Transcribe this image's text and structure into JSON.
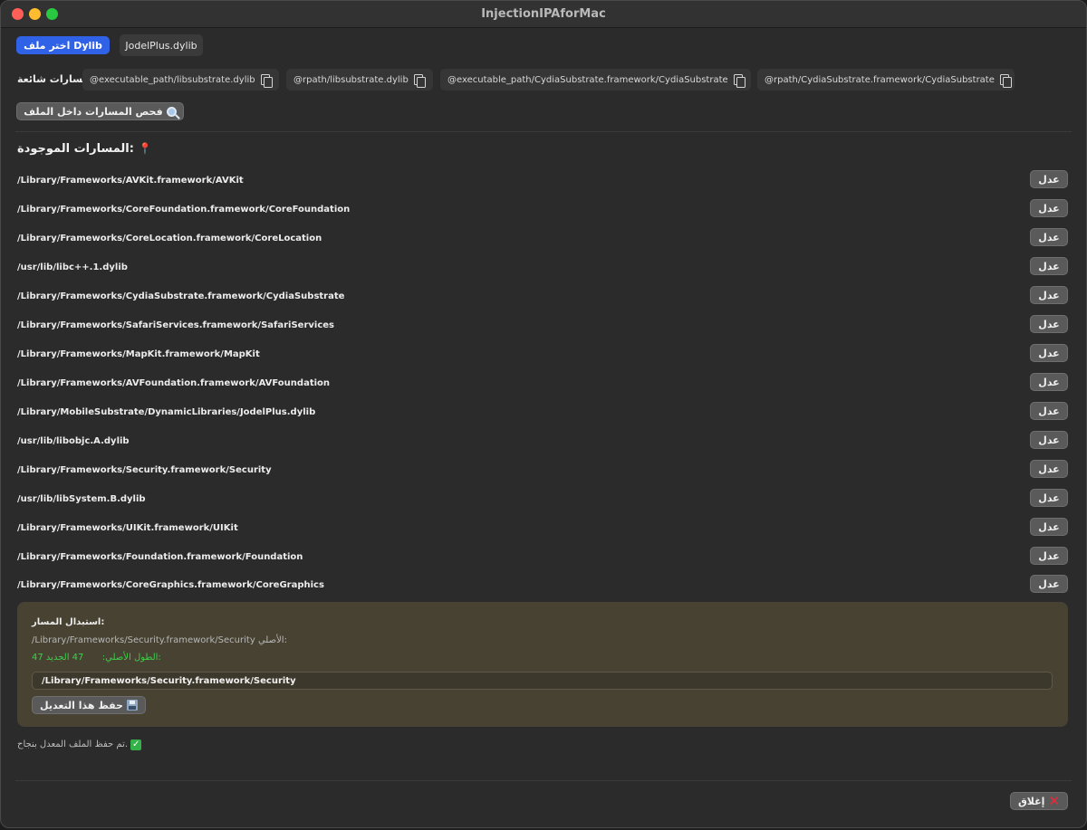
{
  "window": {
    "title": "InjectionIPAforMac"
  },
  "top": {
    "choose_button": "اختر ملف Dylib",
    "selected_file": "JodelPlus.dylib"
  },
  "common_paths": {
    "label": "مسارات شائعة",
    "items": [
      "@executable_path/libsubstrate.dylib",
      "@rpath/libsubstrate.dylib",
      "@executable_path/CydiaSubstrate.framework/CydiaSubstrate",
      "@rpath/CydiaSubstrate.framework/CydiaSubstrate"
    ]
  },
  "scan_button": "فحص المسارات داخل الملف",
  "found": {
    "title": "المسارات الموجودة:",
    "edit_label": "عدل",
    "paths": [
      "/Library/Frameworks/AVKit.framework/AVKit",
      "/Library/Frameworks/CoreFoundation.framework/CoreFoundation",
      "/Library/Frameworks/CoreLocation.framework/CoreLocation",
      "/usr/lib/libc++.1.dylib",
      "/Library/Frameworks/CydiaSubstrate.framework/CydiaSubstrate",
      "/Library/Frameworks/SafariServices.framework/SafariServices",
      "/Library/Frameworks/MapKit.framework/MapKit",
      "/Library/Frameworks/AVFoundation.framework/AVFoundation",
      "/Library/MobileSubstrate/DynamicLibraries/JodelPlus.dylib",
      "/usr/lib/libobjc.A.dylib",
      "/Library/Frameworks/Security.framework/Security",
      "/usr/lib/libSystem.B.dylib",
      "/Library/Frameworks/UIKit.framework/UIKit",
      "/Library/Frameworks/Foundation.framework/Foundation",
      "/Library/Frameworks/CoreGraphics.framework/CoreGraphics"
    ]
  },
  "replace": {
    "title": "استبدال المسار:",
    "original_label": "الأصلي:",
    "original_path": "/Library/Frameworks/Security.framework/Security",
    "original_length_label": "الطول الأصلي:",
    "original_length": "47",
    "new_length_label": "الجديد:",
    "new_length": "47",
    "input_value": "/Library/Frameworks/Security.framework/Security",
    "save_button": "حفظ هذا التعديل"
  },
  "status": {
    "message": "تم حفظ الملف المعدل بنجاح."
  },
  "close_button": "إغلاق",
  "colors": {
    "accent": "#2f62e6",
    "success": "#3cd04a",
    "panel": "#474232"
  }
}
